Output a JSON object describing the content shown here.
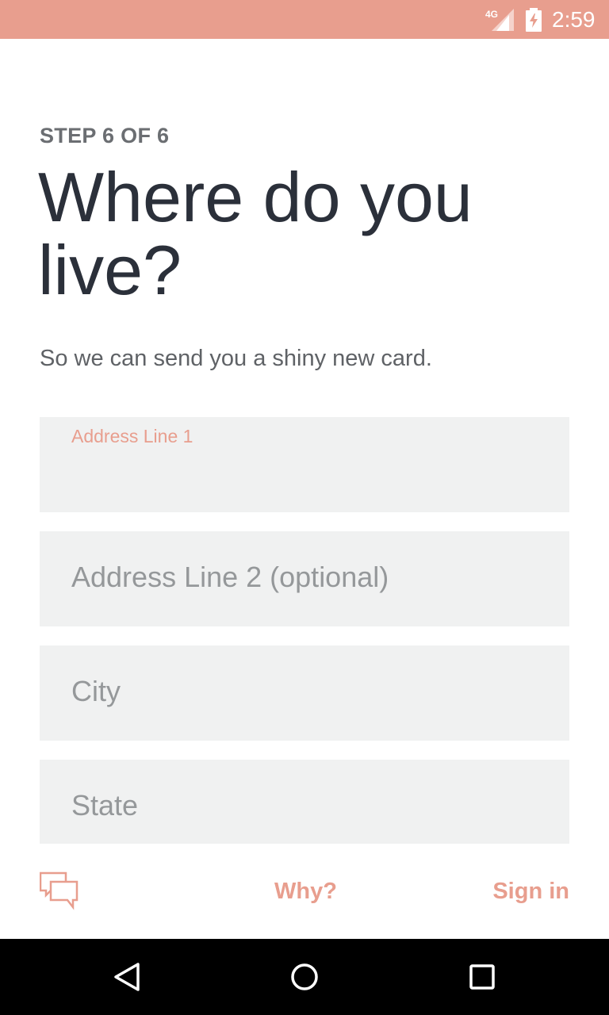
{
  "status_bar": {
    "network": "4G",
    "time": "2:59",
    "background_color": "#e89e8e",
    "icons": [
      "signal-icon",
      "battery-charging-icon"
    ]
  },
  "step": {
    "label": "STEP 6 OF 6"
  },
  "title": "Where do you live?",
  "subtitle": "So we can send you a shiny new card.",
  "fields": {
    "address1": {
      "label": "Address Line 1",
      "value": ""
    },
    "address2": {
      "placeholder": "Address Line 2 (optional)"
    },
    "city": {
      "placeholder": "City"
    },
    "state": {
      "placeholder": "State"
    }
  },
  "footer": {
    "chat_icon": "chat-icon",
    "why_label": "Why?",
    "signin_label": "Sign in",
    "accent_color": "#e89e8e"
  },
  "nav": {
    "back_icon": "back-icon",
    "home_icon": "home-icon",
    "recents_icon": "recents-icon"
  }
}
